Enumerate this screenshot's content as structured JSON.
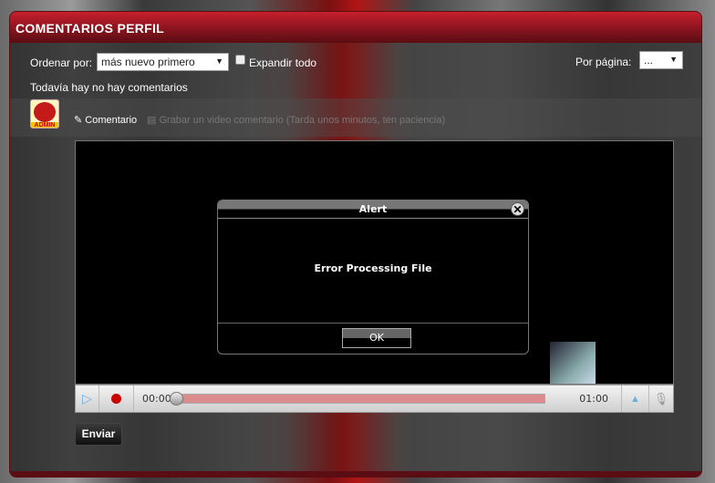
{
  "header": {
    "title": "COMENTARIOS PERFIL"
  },
  "toolbar": {
    "sort_label": "Ordenar por:",
    "sort_value": "más nuevo primero",
    "expand_label": "Expandir todo",
    "per_page_label": "Por página:",
    "per_page_value": "..."
  },
  "empty_message": "Todavía hay no hay comentarios",
  "avatar_text": "ADMIN",
  "tabs": {
    "comment": "Comentario",
    "video": "Grabar un video comentario (Tarda unos minutos, ten paciencia)"
  },
  "player": {
    "current_time": "00:00",
    "total_time": "01:00",
    "progress": 0
  },
  "alert": {
    "title": "Alert",
    "message": "Error Processing File",
    "ok": "OK"
  },
  "submit_label": "Enviar"
}
